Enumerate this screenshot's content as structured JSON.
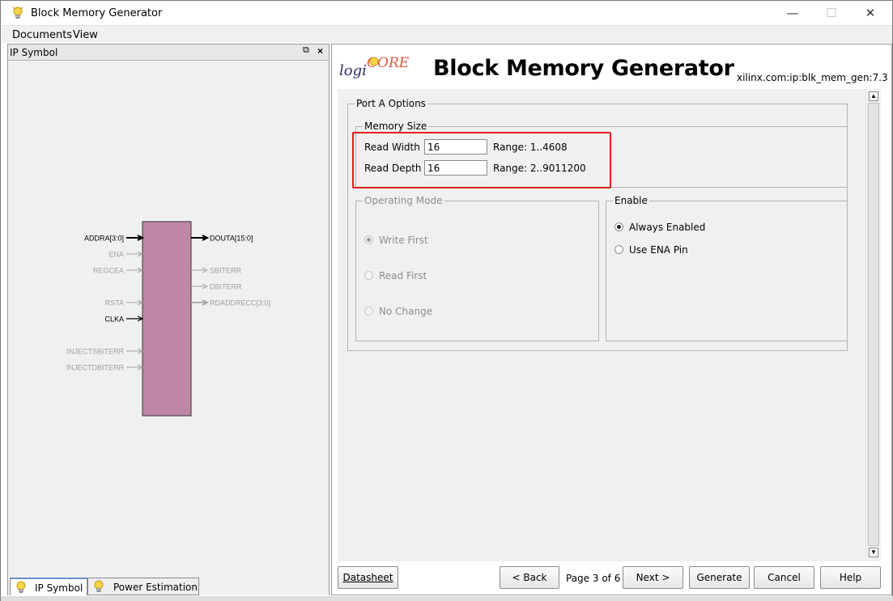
{
  "window": {
    "title": "Block Memory Generator"
  },
  "menu": {
    "items": [
      {
        "label": "Documents"
      },
      {
        "label": "View"
      }
    ]
  },
  "left_panel": {
    "header": "IP Symbol",
    "symbol": {
      "inputs": [
        {
          "label": "ADDRA[3:0]",
          "active": true,
          "bus": true
        },
        {
          "label": "ENA",
          "active": false,
          "bus": false
        },
        {
          "label": "REGCEA",
          "active": false,
          "bus": false
        },
        {
          "label": "RSTA",
          "active": false,
          "bus": false
        },
        {
          "label": "CLKA",
          "active": true,
          "bus": false
        },
        {
          "label": "INJECTSBITERR",
          "active": false,
          "bus": false
        },
        {
          "label": "INJECTDBITERR",
          "active": false,
          "bus": false
        }
      ],
      "outputs": [
        {
          "label": "DOUTA[15:0]",
          "active": true,
          "bus": true
        },
        {
          "label": "SBITERR",
          "active": false,
          "bus": false
        },
        {
          "label": "DBITERR",
          "active": false,
          "bus": false
        },
        {
          "label": "RDADDRECC[3:0]",
          "active": false,
          "bus": true
        }
      ],
      "block_color": "#bf87a7"
    },
    "tabs": [
      {
        "label": "IP Symbol"
      },
      {
        "label": "Power Estimation"
      }
    ]
  },
  "right_panel": {
    "logo_text": {
      "prefix": "logi",
      "suffix": "CORE"
    },
    "title": "Block Memory Generator",
    "vlnv": "xilinx.com:ip:blk_mem_gen:7.3",
    "port_a": {
      "legend": "Port A Options",
      "memory_size": {
        "legend": "Memory Size",
        "read_width_label": "Read Width",
        "read_width_value": "16",
        "read_width_range": "Range: 1..4608",
        "read_depth_label": "Read Depth",
        "read_depth_value": "16",
        "read_depth_range": "Range: 2..9011200"
      },
      "operating_mode": {
        "legend": "Operating Mode",
        "options": [
          "Write First",
          "Read First",
          "No Change"
        ],
        "selected": "Write First"
      },
      "enable": {
        "legend": "Enable",
        "options": [
          "Always Enabled",
          "Use ENA Pin"
        ],
        "selected": "Always Enabled"
      }
    },
    "footer": {
      "datasheet": "Datasheet",
      "back": "< Back",
      "page_status": "Page 3 of 6",
      "next": "Next >",
      "generate": "Generate",
      "cancel": "Cancel",
      "help": "Help"
    }
  },
  "colors": {
    "highlight_box": "#e0201a"
  }
}
